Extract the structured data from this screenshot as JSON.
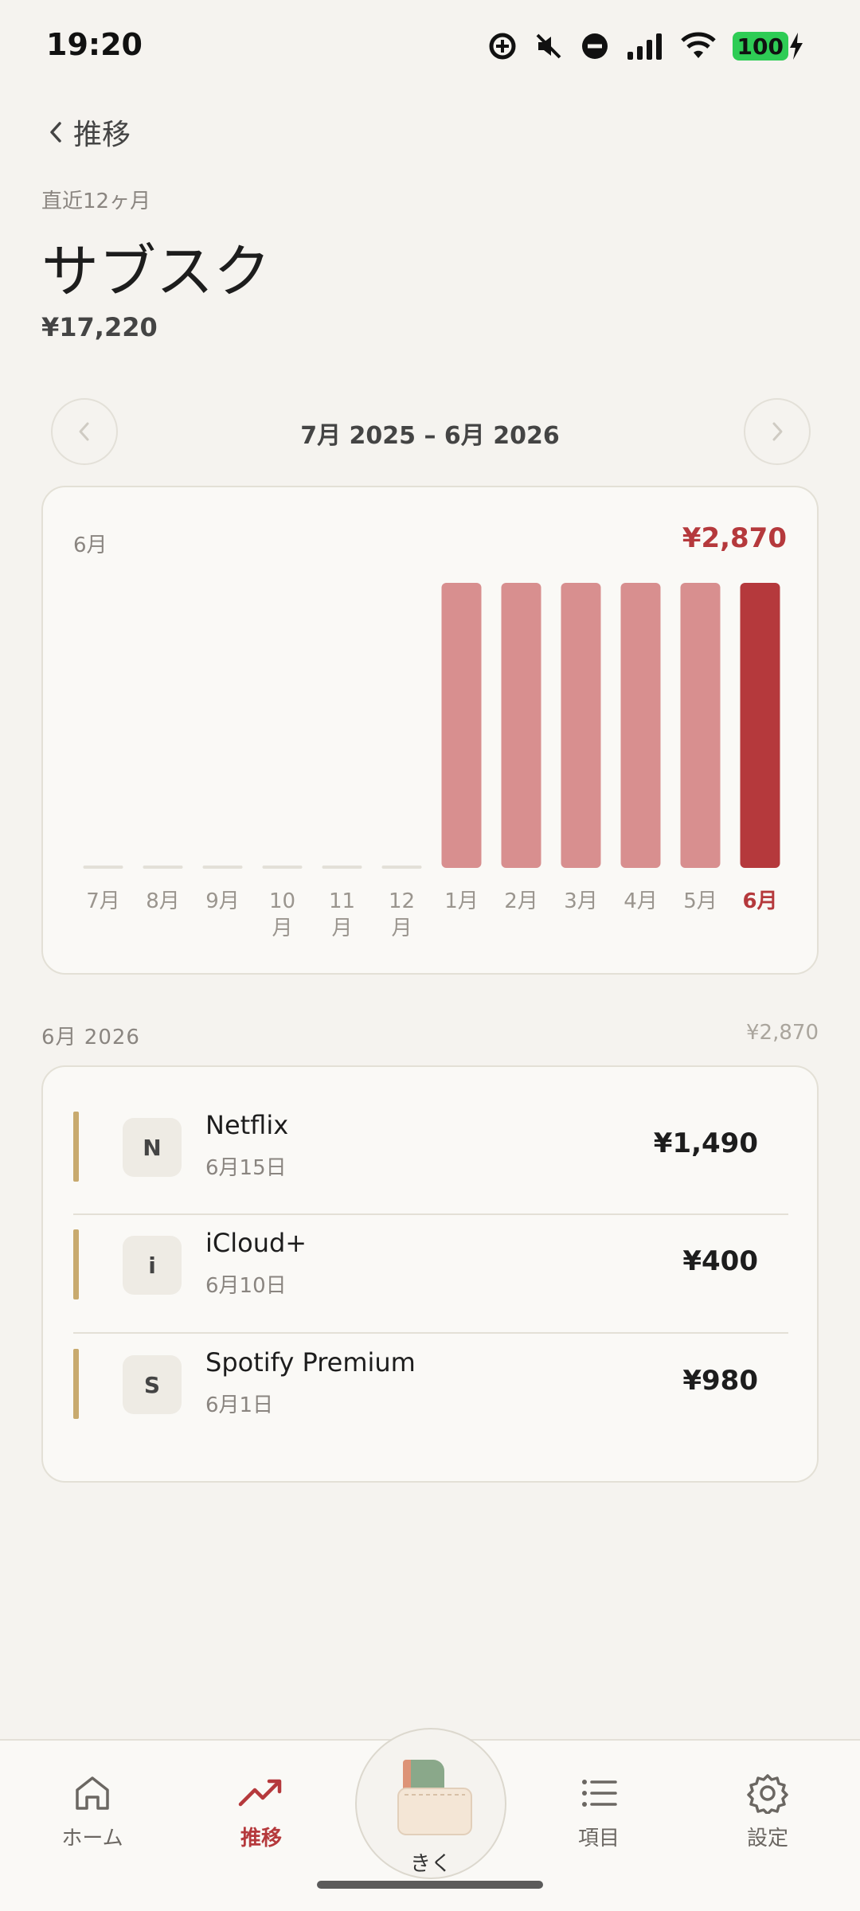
{
  "status_bar": {
    "time": "19:20",
    "battery": "100"
  },
  "header": {
    "back_label": "推移",
    "subtitle": "直近12ヶ月",
    "title": "サブスク",
    "total": "¥17,220"
  },
  "range": {
    "label": "7月 2025 – 6月 2026"
  },
  "chart_card": {
    "selected_month": "6月",
    "selected_amount": "¥2,870"
  },
  "chart_data": {
    "type": "bar",
    "categories": [
      "7月",
      "8月",
      "9月",
      "10月",
      "11月",
      "12月",
      "1月",
      "2月",
      "3月",
      "4月",
      "5月",
      "6月"
    ],
    "values": [
      0,
      0,
      0,
      0,
      0,
      0,
      2870,
      2870,
      2870,
      2870,
      2870,
      2870
    ],
    "selected_index": 11,
    "colors": {
      "bar": "#d88f8f",
      "selected": "#b5393c",
      "empty": "#e3e0d8",
      "label": "#9a958e"
    }
  },
  "section": {
    "month_label": "6月 2026",
    "total": "¥2,870"
  },
  "items": [
    {
      "initial": "N",
      "name": "Netflix",
      "date": "6月15日",
      "amount": "¥1,490"
    },
    {
      "initial": "i",
      "name": "iCloud+",
      "date": "6月10日",
      "amount": "¥400"
    },
    {
      "initial": "S",
      "name": "Spotify Premium",
      "date": "6月1日",
      "amount": "¥980"
    }
  ],
  "bottom_nav": {
    "home": "ホーム",
    "trend": "推移",
    "center": "きく",
    "items": "項目",
    "settings": "設定"
  },
  "theme": {
    "accent": "#b5393c",
    "item_accent": "#c8aa6e",
    "background": "#f5f3ef"
  }
}
